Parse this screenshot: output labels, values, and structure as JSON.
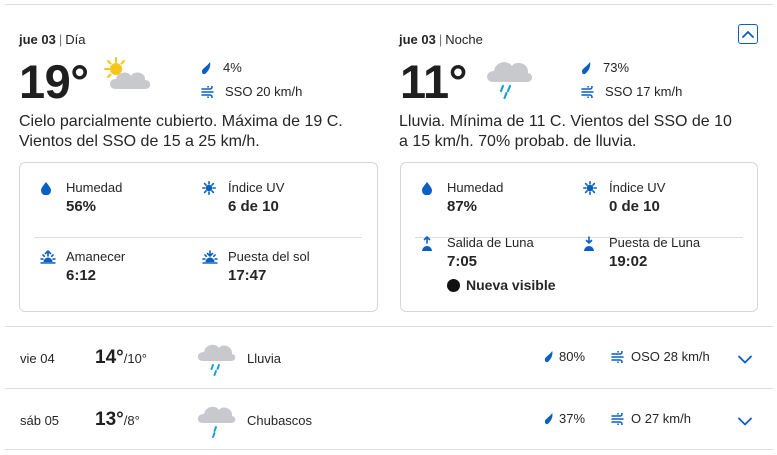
{
  "colors": {
    "accent": "#0a5fc2",
    "sun": "#f5c518",
    "cloud": "#c7c9cc",
    "cloud_dark": "#b4b7bb",
    "rain": "#1aa2d8",
    "border": "#d7d7d7"
  },
  "today": {
    "day": {
      "date": "jue 03",
      "separator": "|",
      "part": "Día",
      "temp": "19°",
      "icon": "partly-cloudy-day-icon",
      "precip": "4%",
      "wind": "SSO 20 km/h",
      "description": "Cielo parcialmente cubierto. Máxima de 19 C. Vientos del SSO de 15 a 25 km/h.",
      "details": {
        "humidity_label": "Humedad",
        "humidity_value": "56%",
        "uv_label": "Índice UV",
        "uv_value": "6 de 10",
        "sunrise_label": "Amanecer",
        "sunrise_value": "6:12",
        "sunset_label": "Puesta del sol",
        "sunset_value": "17:47"
      }
    },
    "night": {
      "date": "jue 03",
      "separator": "|",
      "part": "Noche",
      "temp": "11°",
      "icon": "rain-cloud-icon",
      "precip": "73%",
      "wind": "SSO 17 km/h",
      "description": "Lluvia. Mínima de 11 C. Vientos del SSO de 10 a 15 km/h. 70% probab. de lluvia.",
      "details": {
        "humidity_label": "Humedad",
        "humidity_value": "87%",
        "uv_label": "Índice UV",
        "uv_value": "0 de 10",
        "moonrise_label": "Salida de Luna",
        "moonrise_value": "7:05",
        "moonset_label": "Puesta de Luna",
        "moonset_value": "19:02",
        "moon_phase": "Nueva visible"
      }
    }
  },
  "forecast": [
    {
      "day": "vie 04",
      "high": "14°",
      "low": "/10°",
      "icon": "rain-cloud-icon",
      "condition": "Lluvia",
      "precip": "80%",
      "wind": "OSO 28 km/h"
    },
    {
      "day": "sáb 05",
      "high": "13°",
      "low": "/8°",
      "icon": "shower-cloud-icon",
      "condition": "Chubascos",
      "precip": "37%",
      "wind": "O 27 km/h"
    }
  ]
}
